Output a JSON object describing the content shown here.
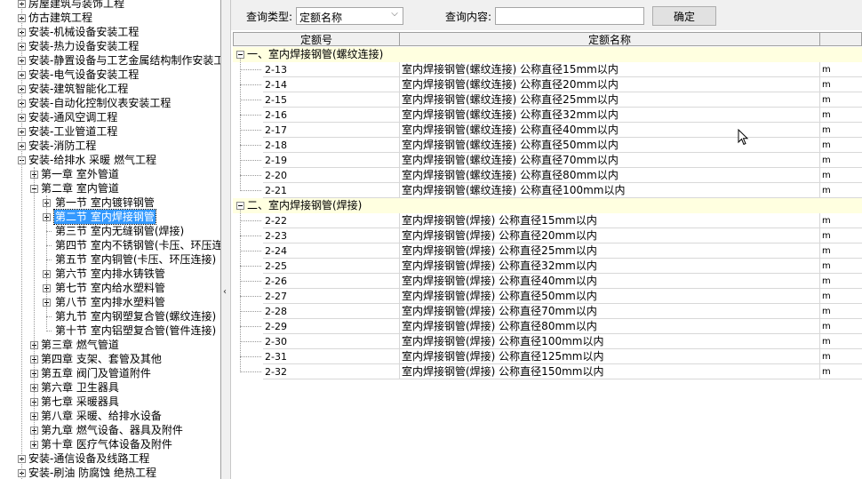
{
  "tree": {
    "items": [
      {
        "label": "房屋建筑与装饰工程",
        "level": 0,
        "expanded": false
      },
      {
        "label": "仿古建筑工程",
        "level": 0,
        "expanded": false
      },
      {
        "label": "安装-机械设备安装工程",
        "level": 0,
        "expanded": false
      },
      {
        "label": "安装-热力设备安装工程",
        "level": 0,
        "expanded": false
      },
      {
        "label": "安装-静置设备与工艺金属结构制作安装工",
        "level": 0,
        "expanded": false
      },
      {
        "label": "安装-电气设备安装工程",
        "level": 0,
        "expanded": false
      },
      {
        "label": "安装-建筑智能化工程",
        "level": 0,
        "expanded": false
      },
      {
        "label": "安装-自动化控制仪表安装工程",
        "level": 0,
        "expanded": false
      },
      {
        "label": "安装-通风空调工程",
        "level": 0,
        "expanded": false
      },
      {
        "label": "安装-工业管道工程",
        "level": 0,
        "expanded": false
      },
      {
        "label": "安装-消防工程",
        "level": 0,
        "expanded": false
      },
      {
        "label": "安装-给排水 采暖 燃气工程",
        "level": 0,
        "expanded": true
      },
      {
        "label": "第一章 室外管道",
        "level": 1,
        "expanded": false
      },
      {
        "label": "第二章 室内管道",
        "level": 1,
        "expanded": true
      },
      {
        "label": "第一节 室内镀锌钢管",
        "level": 2,
        "expanded": false
      },
      {
        "label": "第二节 室内焊接钢管",
        "level": 2,
        "expanded": false,
        "selected": true
      },
      {
        "label": "第三节 室内无缝钢管(焊接)",
        "level": 2,
        "leaf": true
      },
      {
        "label": "第四节 室内不锈钢管(卡压、环压连",
        "level": 2,
        "leaf": true
      },
      {
        "label": "第五节 室内铜管(卡压、环压连接)",
        "level": 2,
        "leaf": true
      },
      {
        "label": "第六节 室内排水铸铁管",
        "level": 2,
        "expanded": false
      },
      {
        "label": "第七节 室内给水塑料管",
        "level": 2,
        "expanded": false
      },
      {
        "label": "第八节 室内排水塑料管",
        "level": 2,
        "expanded": false
      },
      {
        "label": "第九节 室内钢塑复合管(螺纹连接)",
        "level": 2,
        "leaf": true
      },
      {
        "label": "第十节 室内铝塑复合管(管件连接)",
        "level": 2,
        "leaf": true
      },
      {
        "label": "第三章 燃气管道",
        "level": 1,
        "expanded": false
      },
      {
        "label": "第四章 支架、套管及其他",
        "level": 1,
        "expanded": false
      },
      {
        "label": "第五章 阀门及管道附件",
        "level": 1,
        "expanded": false
      },
      {
        "label": "第六章 卫生器具",
        "level": 1,
        "expanded": false
      },
      {
        "label": "第七章 采暖器具",
        "level": 1,
        "expanded": false
      },
      {
        "label": "第八章 采暖、给排水设备",
        "level": 1,
        "expanded": false
      },
      {
        "label": "第九章 燃气设备、器具及附件",
        "level": 1,
        "expanded": false
      },
      {
        "label": "第十章 医疗气体设备及附件",
        "level": 1,
        "expanded": false
      },
      {
        "label": "安装-通信设备及线路工程",
        "level": 0,
        "expanded": false
      },
      {
        "label": "安装-刷油 防腐蚀 绝热工程",
        "level": 0,
        "expanded": false
      }
    ]
  },
  "splitter": {
    "arrow": "‹"
  },
  "search": {
    "type_label": "查询类型:",
    "type_value": "定额名称",
    "content_label": "查询内容:",
    "content_value": "",
    "confirm_label": "确定"
  },
  "grid": {
    "columns": [
      "定额号",
      "定额名称",
      ""
    ],
    "groups": [
      {
        "title": "一、室内焊接钢管(螺纹连接)",
        "rows": [
          {
            "code": "2-13",
            "name": "室内焊接钢管(螺纹连接) 公称直径15mm以内",
            "unit": "m"
          },
          {
            "code": "2-14",
            "name": "室内焊接钢管(螺纹连接) 公称直径20mm以内",
            "unit": "m"
          },
          {
            "code": "2-15",
            "name": "室内焊接钢管(螺纹连接) 公称直径25mm以内",
            "unit": "m"
          },
          {
            "code": "2-16",
            "name": "室内焊接钢管(螺纹连接) 公称直径32mm以内",
            "unit": "m"
          },
          {
            "code": "2-17",
            "name": "室内焊接钢管(螺纹连接) 公称直径40mm以内",
            "unit": "m"
          },
          {
            "code": "2-18",
            "name": "室内焊接钢管(螺纹连接) 公称直径50mm以内",
            "unit": "m"
          },
          {
            "code": "2-19",
            "name": "室内焊接钢管(螺纹连接) 公称直径70mm以内",
            "unit": "m"
          },
          {
            "code": "2-20",
            "name": "室内焊接钢管(螺纹连接) 公称直径80mm以内",
            "unit": "m"
          },
          {
            "code": "2-21",
            "name": "室内焊接钢管(螺纹连接) 公称直径100mm以内",
            "unit": "m"
          }
        ]
      },
      {
        "title": "二、室内焊接钢管(焊接)",
        "rows": [
          {
            "code": "2-22",
            "name": "室内焊接钢管(焊接) 公称直径15mm以内",
            "unit": "m"
          },
          {
            "code": "2-23",
            "name": "室内焊接钢管(焊接) 公称直径20mm以内",
            "unit": "m"
          },
          {
            "code": "2-24",
            "name": "室内焊接钢管(焊接) 公称直径25mm以内",
            "unit": "m"
          },
          {
            "code": "2-25",
            "name": "室内焊接钢管(焊接) 公称直径32mm以内",
            "unit": "m"
          },
          {
            "code": "2-26",
            "name": "室内焊接钢管(焊接) 公称直径40mm以内",
            "unit": "m"
          },
          {
            "code": "2-27",
            "name": "室内焊接钢管(焊接) 公称直径50mm以内",
            "unit": "m"
          },
          {
            "code": "2-28",
            "name": "室内焊接钢管(焊接) 公称直径70mm以内",
            "unit": "m"
          },
          {
            "code": "2-29",
            "name": "室内焊接钢管(焊接) 公称直径80mm以内",
            "unit": "m"
          },
          {
            "code": "2-30",
            "name": "室内焊接钢管(焊接) 公称直径100mm以内",
            "unit": "m"
          },
          {
            "code": "2-31",
            "name": "室内焊接钢管(焊接) 公称直径125mm以内",
            "unit": "m"
          },
          {
            "code": "2-32",
            "name": "室内焊接钢管(焊接) 公称直径150mm以内",
            "unit": "m"
          }
        ]
      }
    ]
  },
  "colors": {
    "selection": "#3399ff",
    "group_bg": "#ffffe0",
    "toolbar_bg": "#f0f0f0"
  }
}
